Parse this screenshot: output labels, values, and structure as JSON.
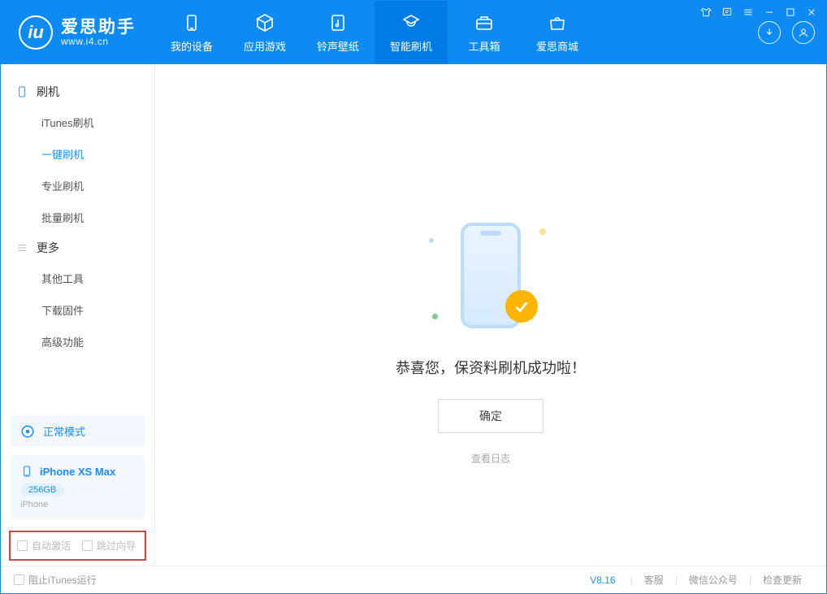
{
  "app": {
    "title": "爱思助手",
    "subtitle": "www.i4.cn"
  },
  "nav": {
    "tabs": [
      {
        "label": "我的设备",
        "icon": "device"
      },
      {
        "label": "应用游戏",
        "icon": "cube"
      },
      {
        "label": "铃声壁纸",
        "icon": "music"
      },
      {
        "label": "智能刷机",
        "icon": "refresh",
        "active": true
      },
      {
        "label": "工具箱",
        "icon": "toolbox"
      },
      {
        "label": "爱思商城",
        "icon": "shop"
      }
    ]
  },
  "sidebar": {
    "section1": {
      "title": "刷机",
      "items": [
        "iTunes刷机",
        "一键刷机",
        "专业刷机",
        "批量刷机"
      ],
      "active_index": 1
    },
    "section2": {
      "title": "更多",
      "items": [
        "其他工具",
        "下载固件",
        "高级功能"
      ]
    },
    "mode": "正常模式",
    "device": {
      "name": "iPhone XS Max",
      "storage": "256GB",
      "type": "iPhone"
    },
    "checkboxes": {
      "auto_activate": "自动激活",
      "skip_guide": "跳过向导"
    }
  },
  "main": {
    "success_message": "恭喜您，保资料刷机成功啦！",
    "ok_label": "确定",
    "view_log_label": "查看日志"
  },
  "footer": {
    "block_itunes": "阻止iTunes运行",
    "version": "V8.16",
    "links": [
      "客服",
      "微信公众号",
      "检查更新"
    ]
  }
}
